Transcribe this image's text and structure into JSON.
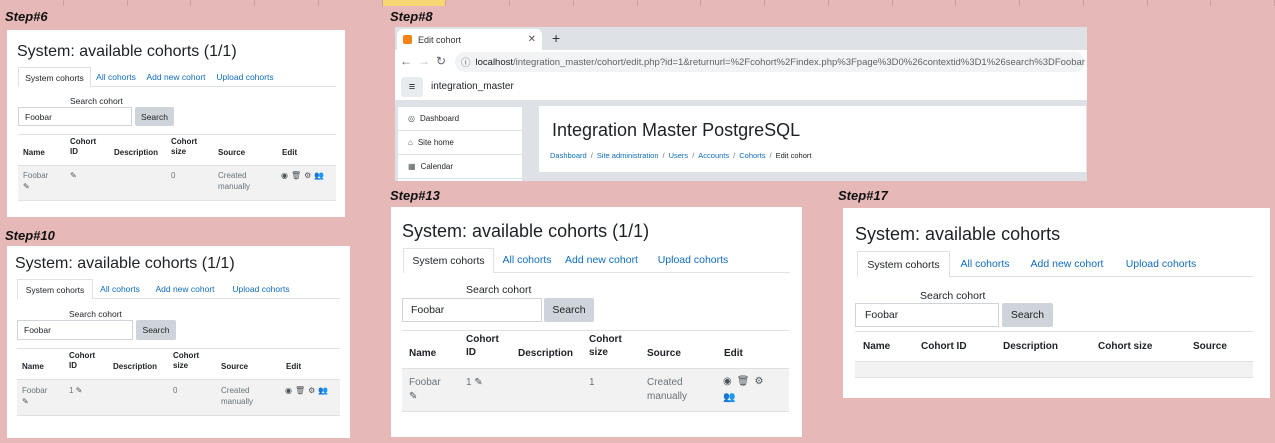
{
  "steps": {
    "s6": "Step#6",
    "s8": "Step#8",
    "s10": "Step#10",
    "s13": "Step#13",
    "s17": "Step#17"
  },
  "panels": {
    "p6": {
      "title": "System: available cohorts (1/1)",
      "tabs": [
        "System cohorts",
        "All cohorts",
        "Add new cohort",
        "Upload cohorts"
      ],
      "search_label": "Search cohort",
      "search_value": "Foobar",
      "search_button": "Search",
      "headers": [
        "Name",
        "Cohort ID",
        "Description",
        "Cohort size",
        "Source",
        "Edit"
      ],
      "row": {
        "name": "Foobar",
        "cohort_id": "",
        "description": "",
        "size": "0",
        "source": "Created manually"
      }
    },
    "p10": {
      "title": "System: available cohorts (1/1)",
      "tabs": [
        "System cohorts",
        "All cohorts",
        "Add new cohort",
        "Upload cohorts"
      ],
      "search_label": "Search cohort",
      "search_value": "Foobar",
      "search_button": "Search",
      "headers": [
        "Name",
        "Cohort ID",
        "Description",
        "Cohort size",
        "Source",
        "Edit"
      ],
      "row": {
        "name": "Foobar",
        "cohort_id": "1",
        "description": "",
        "size": "0",
        "source": "Created manually"
      }
    },
    "p13": {
      "title": "System: available cohorts (1/1)",
      "tabs": [
        "System cohorts",
        "All cohorts",
        "Add new cohort",
        "Upload cohorts"
      ],
      "search_label": "Search cohort",
      "search_value": "Foobar",
      "search_button": "Search",
      "headers": [
        "Name",
        "Cohort ID",
        "Description",
        "Cohort size",
        "Source",
        "Edit"
      ],
      "row": {
        "name": "Foobar",
        "cohort_id": "1",
        "description": "",
        "size": "1",
        "source": "Created manually"
      }
    },
    "p17": {
      "title": "System: available cohorts",
      "tabs": [
        "System cohorts",
        "All cohorts",
        "Add new cohort",
        "Upload cohorts"
      ],
      "search_label": "Search cohort",
      "search_value": "Foobar",
      "search_button": "Search",
      "headers": [
        "Name",
        "Cohort ID",
        "Description",
        "Cohort size",
        "Source"
      ]
    }
  },
  "browser": {
    "tab_title": "Edit cohort",
    "url_host": "localhost",
    "url_path": "/integration_master/cohort/edit.php?id=1&returnurl=%2Fcohort%2Findex.php%3Fpage%3D0%26contextid%3D1%26search%3DFoobar",
    "site_name": "integration_master",
    "drawer": [
      "Dashboard",
      "Site home",
      "Calendar"
    ],
    "page_title": "Integration Master PostgreSQL",
    "breadcrumbs": [
      "Dashboard",
      "Site administration",
      "Users",
      "Accounts",
      "Cohorts",
      "Edit cohort"
    ]
  },
  "icons": {
    "pencil": "✎",
    "eye": "◉",
    "trash": "🗑",
    "gear": "⚙",
    "users": "👥"
  }
}
